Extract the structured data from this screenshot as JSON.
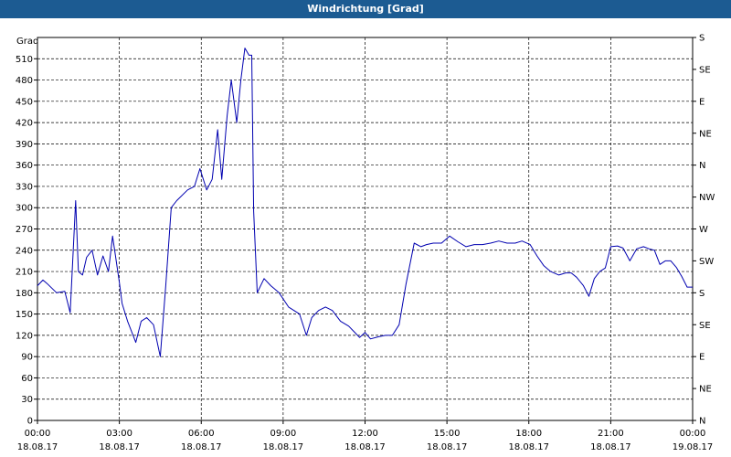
{
  "window": {
    "title": "Windrichtung [Grad]"
  },
  "chart_data": {
    "type": "line",
    "ylabel": "Grad",
    "ylim": [
      0,
      540
    ],
    "yticks": [
      0,
      30,
      60,
      90,
      120,
      150,
      180,
      210,
      240,
      270,
      300,
      330,
      360,
      390,
      420,
      450,
      480,
      510
    ],
    "y2_ticks": [
      {
        "value": 0,
        "label": "N"
      },
      {
        "value": 45,
        "label": "NE"
      },
      {
        "value": 90,
        "label": "E"
      },
      {
        "value": 135,
        "label": "SE"
      },
      {
        "value": 180,
        "label": "S"
      },
      {
        "value": 225,
        "label": "SW"
      },
      {
        "value": 270,
        "label": "W"
      },
      {
        "value": 315,
        "label": "NW"
      },
      {
        "value": 360,
        "label": "N"
      },
      {
        "value": 405,
        "label": "NE"
      },
      {
        "value": 450,
        "label": "E"
      },
      {
        "value": 495,
        "label": "SE"
      },
      {
        "value": 540,
        "label": "S"
      }
    ],
    "xlim": [
      0,
      24
    ],
    "xticks": [
      {
        "value": 0,
        "time": "00:00",
        "date": "18.08.17"
      },
      {
        "value": 3,
        "time": "03:00",
        "date": "18.08.17"
      },
      {
        "value": 6,
        "time": "06:00",
        "date": "18.08.17"
      },
      {
        "value": 9,
        "time": "09:00",
        "date": "18.08.17"
      },
      {
        "value": 12,
        "time": "12:00",
        "date": "18.08.17"
      },
      {
        "value": 15,
        "time": "15:00",
        "date": "18.08.17"
      },
      {
        "value": 18,
        "time": "18:00",
        "date": "18.08.17"
      },
      {
        "value": 21,
        "time": "21:00",
        "date": "18.08.17"
      },
      {
        "value": 24,
        "time": "00:00",
        "date": "19.08.17"
      }
    ],
    "grid": true,
    "line_color": "#0000b0",
    "series": [
      {
        "x": [
          0.0,
          0.2,
          0.35,
          0.7,
          1.0,
          1.2,
          1.4,
          1.5,
          1.65,
          1.8,
          2.0,
          2.2,
          2.4,
          2.6,
          2.75,
          3.0,
          3.1,
          3.3,
          3.6,
          3.8,
          4.0,
          4.25,
          4.5,
          4.7,
          4.9,
          5.1,
          5.5,
          5.75,
          5.95,
          6.2,
          6.4,
          6.6,
          6.75,
          6.95,
          7.1,
          7.3,
          7.45,
          7.6,
          7.75,
          7.85,
          7.92,
          8.05,
          8.3,
          8.55,
          8.85,
          9.2,
          9.6,
          9.85,
          10.05,
          10.3,
          10.55,
          10.8,
          11.1,
          11.4,
          11.6,
          11.8,
          12.0,
          12.2,
          12.5,
          12.75,
          13.0,
          13.25,
          13.5,
          13.8,
          14.05,
          14.25,
          14.5,
          14.8,
          15.1,
          15.4,
          15.7,
          16.0,
          16.3,
          16.6,
          16.9,
          17.2,
          17.5,
          17.75,
          18.05,
          18.3,
          18.55,
          18.8,
          19.1,
          19.35,
          19.55,
          19.75,
          20.0,
          20.2,
          20.4,
          20.6,
          20.8,
          21.0,
          21.25,
          21.45,
          21.7,
          21.95,
          22.2,
          22.4,
          22.6,
          22.8,
          23.0,
          23.2,
          23.4,
          23.6,
          23.8,
          24.0
        ],
        "y": [
          190,
          198,
          193,
          180,
          182,
          152,
          310,
          210,
          205,
          230,
          240,
          205,
          232,
          210,
          260,
          195,
          165,
          140,
          110,
          140,
          145,
          135,
          90,
          190,
          300,
          310,
          325,
          330,
          355,
          325,
          340,
          410,
          340,
          430,
          480,
          420,
          480,
          525,
          515,
          515,
          295,
          180,
          200,
          190,
          180,
          160,
          150,
          120,
          145,
          155,
          160,
          155,
          140,
          133,
          125,
          117,
          124,
          115,
          118,
          120,
          120,
          135,
          192,
          250,
          245,
          248,
          250,
          250,
          260,
          252,
          245,
          248,
          248,
          250,
          253,
          250,
          250,
          253,
          248,
          232,
          218,
          210,
          205,
          208,
          208,
          202,
          190,
          175,
          200,
          210,
          215,
          245,
          246,
          243,
          225,
          242,
          245,
          242,
          240,
          220,
          225,
          225,
          216,
          203,
          188,
          188
        ]
      }
    ]
  }
}
